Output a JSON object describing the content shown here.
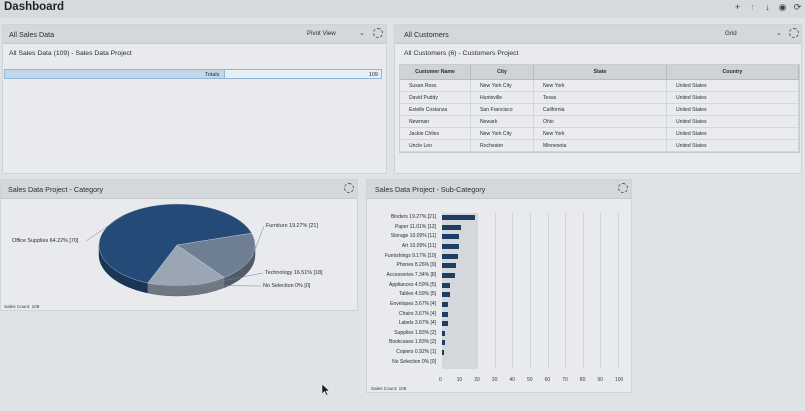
{
  "header": {
    "title": "Dashboard",
    "icons": [
      "plus-icon",
      "arrow-up-icon",
      "arrow-down-icon",
      "eye-icon",
      "refresh-icon"
    ]
  },
  "all_sales": {
    "title": "All Sales Data",
    "view": "Pivot View",
    "subtitle": "All Sales Data (109) - Sales Data Project",
    "totals_label": "Totals",
    "totals_value": "109"
  },
  "customers": {
    "title": "All Customers",
    "view": "Grid",
    "subtitle": "All Customers (6) - Customers Project",
    "columns": [
      "Customer Name",
      "City",
      "State",
      "Country"
    ],
    "rows": [
      [
        "Susan Ross",
        "New York City",
        "New York",
        "United States"
      ],
      [
        "David Puddy",
        "Huntsville",
        "Texas",
        "United States"
      ],
      [
        "Estelle Costanza",
        "San Francisco",
        "California",
        "United States"
      ],
      [
        "Newman",
        "Newark",
        "Ohio",
        "United States"
      ],
      [
        "Jackie Chiles",
        "New York City",
        "New York",
        "United States"
      ],
      [
        "Uncle Leo",
        "Rochester",
        "Minnesota",
        "United States"
      ]
    ]
  },
  "category_panel": {
    "title": "Sales Data Project - Category",
    "footer": "Sales Count: 109"
  },
  "subcategory_panel": {
    "title": "Sales Data Project - Sub-Category",
    "footer": "Sales Count: 109"
  },
  "chart_data": [
    {
      "type": "pie",
      "title": "Sales Data Project - Category",
      "labels": [
        "Office Supplies 64.22% [70]",
        "Furniture 19.27% [21]",
        "Technology 16.51% [18]",
        "No Selection 0% [0]"
      ],
      "categories": [
        "Office Supplies",
        "Furniture",
        "Technology",
        "No Selection"
      ],
      "values": [
        70,
        21,
        18,
        0
      ],
      "colors": [
        "#244a78",
        "#6f7f93",
        "#9aa6b4",
        "#c6ccd3"
      ]
    },
    {
      "type": "bar",
      "orientation": "horizontal",
      "title": "Sales Data Project - Sub-Category",
      "labels": [
        "Binders 19.27% [21]",
        "Paper 11.01% [12]",
        "Storage 10.09% [11]",
        "Art 10.09% [11]",
        "Furnishings 9.17% [10]",
        "Phones 8.26% [9]",
        "Accessories 7.34% [8]",
        "Appliances 4.59% [5]",
        "Tables 4.59% [5]",
        "Envelopes 3.67% [4]",
        "Chairs 3.67% [4]",
        "Labels 3.67% [4]",
        "Supplies 1.83% [2]",
        "Bookcases 1.83% [2]",
        "Copiers 0.92% [1]",
        "No Selection 0% [0]"
      ],
      "values": [
        21,
        12,
        11,
        11,
        10,
        9,
        8,
        5,
        5,
        4,
        4,
        4,
        2,
        2,
        1,
        0
      ],
      "xlim": [
        0,
        100
      ],
      "xticks": [
        "0",
        "10",
        "20",
        "30",
        "40",
        "50",
        "60",
        "70",
        "80",
        "90",
        "100"
      ],
      "color": "#1e3d63"
    }
  ],
  "cursor_icon": "mouse-pointer-icon"
}
